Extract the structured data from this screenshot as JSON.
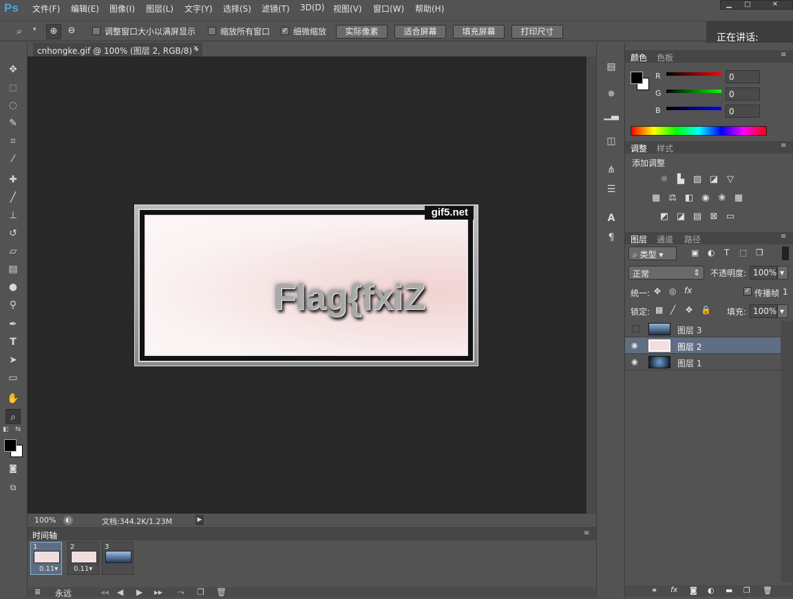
{
  "app": {
    "logo": "Ps"
  },
  "menu": [
    "文件(F)",
    "编辑(E)",
    "图像(I)",
    "图层(L)",
    "文字(Y)",
    "选择(S)",
    "滤镜(T)",
    "3D(D)",
    "视图(V)",
    "窗口(W)",
    "帮助(H)"
  ],
  "window_buttons": [
    "▁",
    "□",
    "✕"
  ],
  "options": {
    "fit_window": "调整窗口大小以满屏显示",
    "zoom_all": "缩放所有窗口",
    "scrubby": "细微缩放",
    "btn_actual": "实际像素",
    "btn_fit": "适合屏幕",
    "btn_fill": "填充屏幕",
    "btn_print": "打印尺寸"
  },
  "speaking": "正在讲话:",
  "document": {
    "tab_title": "cnhongke.gif @ 100% (图层 2, RGB/8) *",
    "watermark": "gif5.net",
    "image_text": "Flag{fxiZ"
  },
  "status": {
    "zoom": "100%",
    "doc": "文档:344.2K/1.23M"
  },
  "timeline": {
    "title": "时间轴",
    "frames": [
      {
        "num": "1",
        "delay": "0.11▾"
      },
      {
        "num": "2",
        "delay": "0.11▾"
      },
      {
        "num": "3",
        "delay": ""
      }
    ],
    "loop": "永远"
  },
  "color_panel": {
    "tab_color": "颜色",
    "tab_swatches": "色板",
    "r_label": "R",
    "g_label": "G",
    "b_label": "B",
    "r": "0",
    "g": "0",
    "b": "0"
  },
  "adjust_panel": {
    "tab_adjust": "调整",
    "tab_styles": "样式",
    "heading": "添加调整"
  },
  "layers_panel": {
    "tab_layers": "图层",
    "tab_channels": "通道",
    "tab_paths": "路径",
    "kind": "类型",
    "blend": "正常",
    "opacity_label": "不透明度:",
    "opacity": "100%",
    "unify_label": "统一:",
    "propagate": "传播帧",
    "propagate_n": "1",
    "lock_label": "锁定:",
    "fill_label": "填充:",
    "fill": "100%",
    "layers": [
      {
        "name": "图层 3"
      },
      {
        "name": "图层 2"
      },
      {
        "name": "图层 1"
      }
    ]
  }
}
